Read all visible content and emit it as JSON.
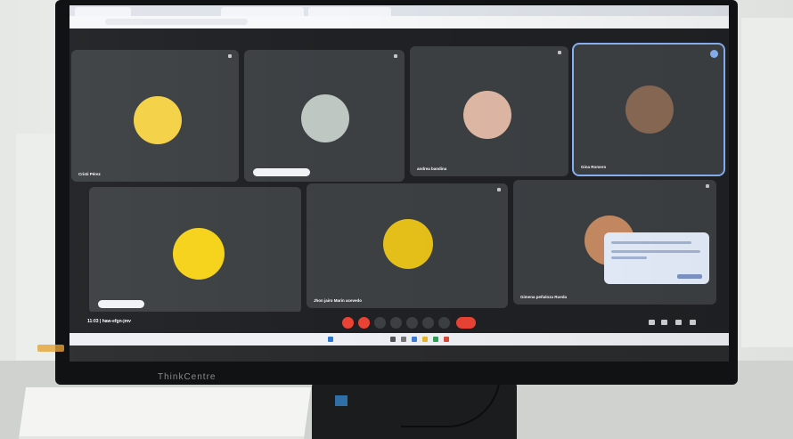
{
  "participants": [
    {
      "name": "Cristi Pérez",
      "avatar_color": "#f4d247"
    },
    {
      "name": "",
      "pill_label": "",
      "avatar_color": "#bfc7c2"
    },
    {
      "name": "andrea bandina",
      "avatar_color": "#e0b8a6"
    },
    {
      "name": "Gina Romero",
      "avatar_color": "#8a6a55"
    },
    {
      "name": "",
      "pill_label": "",
      "avatar_color": "#f6d21a"
    },
    {
      "name": "Jhon jairo Marin acevedo",
      "avatar_color": "#e6c019"
    },
    {
      "name": "Gimena peñaloza Rueda",
      "avatar_color": "#c98c63"
    }
  ],
  "meeting": {
    "time": "11:03",
    "code": "haw-efgn-jmv"
  },
  "monitor": {
    "brand": "ThinkCentre"
  },
  "colors": {
    "meet_bg": "#202124",
    "tile": "#3c4043",
    "active": "#8ab4f8",
    "end_call": "#ea4335"
  }
}
